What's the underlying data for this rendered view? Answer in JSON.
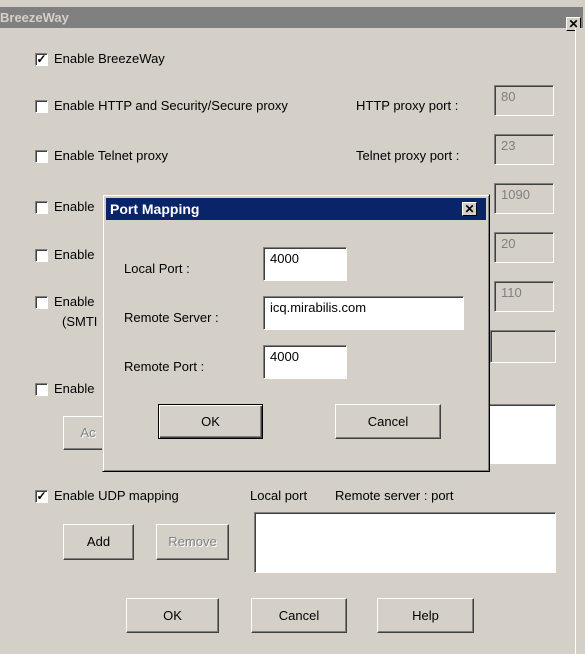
{
  "window": {
    "title": "BreezeWay",
    "close_glyph": "✕"
  },
  "options": {
    "enable_breezeway": {
      "label": "Enable BreezeWay",
      "checked": true
    },
    "http_proxy": {
      "label": "Enable HTTP and Security/Secure proxy",
      "checked": false,
      "port_label": "HTTP proxy port :",
      "port": "80"
    },
    "telnet_proxy": {
      "label": "Telnet proxy port :",
      "enable_label": "Enable Telnet proxy",
      "checked": false,
      "port": "23"
    },
    "row3": {
      "label": "Enable",
      "checked": false,
      "port": "1090"
    },
    "row4": {
      "label": "Enable",
      "checked": false,
      "port": "20"
    },
    "row5": {
      "label": "Enable",
      "sublabel": "(SMTI",
      "checked": false,
      "port": "110"
    },
    "row6": {
      "label": "Enable",
      "checked": false,
      "add_label": "Ac"
    },
    "udp_mapping": {
      "label": "Enable UDP mapping",
      "checked": true,
      "local_port_header": "Local port",
      "remote_header": "Remote server : port",
      "add_label": "Add",
      "remove_label": "Remove"
    }
  },
  "footer": {
    "ok_label": "OK",
    "cancel_label": "Cancel",
    "help_label": "Help"
  },
  "dialog": {
    "title": "Port Mapping",
    "close_glyph": "✕",
    "local_port_label": "Local Port :",
    "local_port_value": "4000",
    "remote_server_label": "Remote Server :",
    "remote_server_value": "icq.mirabilis.com",
    "remote_port_label": "Remote Port :",
    "remote_port_value": "4000",
    "ok_label": "OK",
    "cancel_label": "Cancel"
  },
  "check_glyph": "✓"
}
